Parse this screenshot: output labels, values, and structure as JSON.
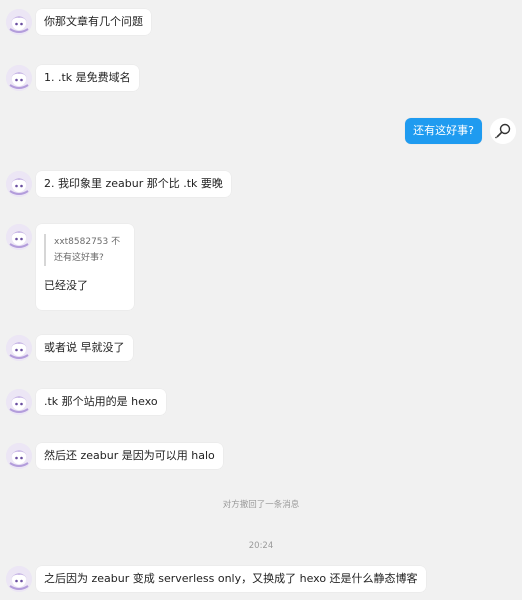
{
  "messages": [
    {
      "id": "m1",
      "text": "你那文章有几个问题"
    },
    {
      "id": "m2",
      "text": "1. .tk 是免费域名"
    },
    {
      "id": "m3",
      "text": "还有这好事?"
    },
    {
      "id": "m4",
      "text": "2. 我印象里 zeabur 那个比 .tk 要晚"
    },
    {
      "id": "m5",
      "quote_author": "xxt8582753",
      "quote_suffix": "不",
      "quote_text": "还有这好事?",
      "text": "已经没了"
    },
    {
      "id": "m6",
      "text": "或者说 早就没了"
    },
    {
      "id": "m7",
      "text": ".tk 那个站用的是 hexo"
    },
    {
      "id": "m8",
      "text": "然后还 zeabur 是因为可以用 halo"
    },
    {
      "id": "m9",
      "text": "之后因为 zeabur 变成 serverless only，又换成了 hexo 还是什么静态博客"
    }
  ],
  "system": {
    "recall_notice": "对方撤回了一条消息",
    "timestamp": "20:24"
  },
  "colors": {
    "background": "#f1f1f1",
    "bubble_other": "#ffffff",
    "bubble_self": "#1f9bf0"
  }
}
